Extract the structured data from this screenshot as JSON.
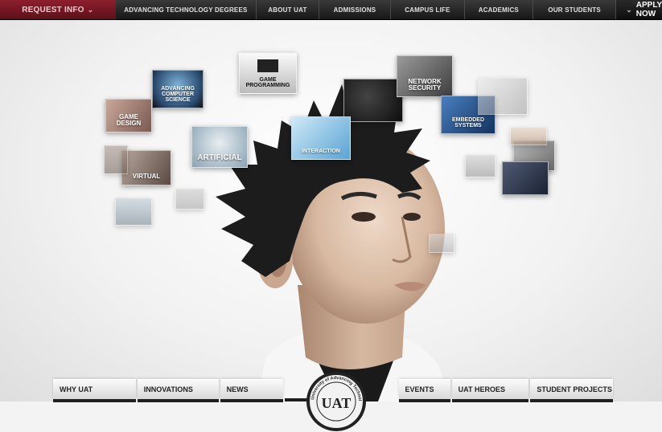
{
  "topnav": {
    "request_info": "REQUEST INFO",
    "items": [
      "ADVANCING TECHNOLOGY DEGREES",
      "ABOUT UAT",
      "ADMISSIONS",
      "CAMPUS LIFE",
      "ACADEMICS",
      "OUR STUDENTS"
    ],
    "apply_now": "APPLY NOW"
  },
  "thumbnails": {
    "game_programming": "GAME\nPROGRAMMING",
    "computer_science": "ADVANCING\nCOMPUTER\nSCIENCE",
    "game_design": "GAME\nDESIGN",
    "artificial": "ARTIFICIAL",
    "virtual": "VIRTUAL",
    "network_security": "NETWORK\nSECURITY",
    "interaction": "INTERACTION",
    "embedded": "EMBEDDED\nSYSTEMS"
  },
  "bottomnav": {
    "items": [
      "WHY UAT",
      "INNOVATIONS",
      "NEWS",
      "EVENTS",
      "UAT HEROES",
      "STUDENT PROJECTS"
    ],
    "logo_ring_text": "University of Advancing Technology",
    "logo_text": "UAT"
  },
  "colors": {
    "request_info_bg": "#7a1a26",
    "nav_bg": "#1f1f1f",
    "hero_bg": "#f3f3f3"
  }
}
